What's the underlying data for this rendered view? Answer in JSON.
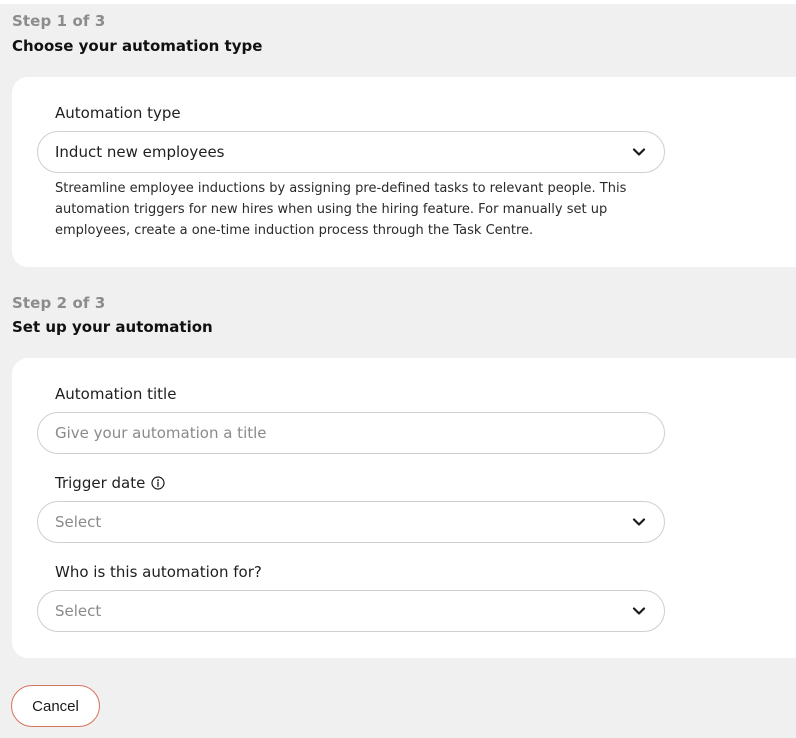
{
  "colors": {
    "page_background": "#f0f0f0",
    "card_background": "#ffffff",
    "cancel_border": "#d6735c",
    "muted_text": "#8c8c8c"
  },
  "step1": {
    "label": "Step 1 of 3",
    "title": "Choose your automation type",
    "automation_type": {
      "label": "Automation type",
      "selected": "Induct new employees",
      "icon": "chevron-down-icon"
    },
    "description": "Streamline employee inductions by assigning pre-defined tasks to relevant people. This automation triggers for new hires when using the hiring feature. For manually set up employees, create a one-time induction process through the Task Centre."
  },
  "step2": {
    "label": "Step 2 of 3",
    "title": "Set up your automation",
    "automation_title": {
      "label": "Automation title",
      "placeholder": "Give your automation a title",
      "value": ""
    },
    "trigger_date": {
      "label": "Trigger date",
      "info_icon": "info-icon",
      "placeholder": "Select",
      "icon": "chevron-down-icon"
    },
    "audience": {
      "label": "Who is this automation for?",
      "placeholder": "Select",
      "icon": "chevron-down-icon"
    }
  },
  "actions": {
    "cancel_label": "Cancel"
  }
}
